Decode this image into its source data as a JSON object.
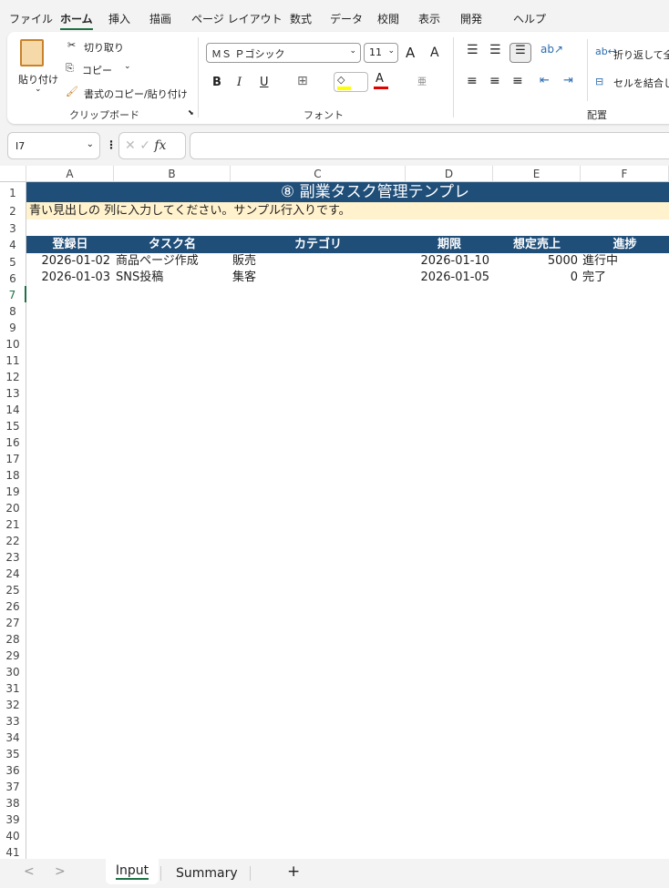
{
  "menu": [
    "ファイル",
    "ホーム",
    "挿入",
    "描画",
    "ページ レイアウト",
    "数式",
    "データ",
    "校閲",
    "表示",
    "開発",
    "ヘルプ"
  ],
  "ribbon": {
    "paste": "貼り付け",
    "cut": "切り取り",
    "copy": "コピー",
    "format_painter": "書式のコピー/貼り付け",
    "clipboard_group": "クリップボード",
    "font_name": "ＭＳ Ｐゴシック",
    "font_size": "11",
    "bold": "B",
    "italic": "I",
    "underline": "U",
    "font_color_letter": "A",
    "grow": "A",
    "shrink": "A",
    "font_group": "フォント",
    "wrap_text": "折り返して全",
    "merge": "セルを結合し",
    "alignment_group": "配置",
    "fill_color": "#ffff00",
    "font_color": "#e00000"
  },
  "formula_bar": {
    "name_box": "I7",
    "fx": "fx",
    "formula": ""
  },
  "columns": [
    "A",
    "B",
    "C",
    "D",
    "E",
    "F"
  ],
  "sheet": {
    "title": "⑧ 副業タスク管理テンプレ",
    "note": "青い見出しの 列に入力してください。サンプル行入りです。",
    "headers": [
      "登録日",
      "タスク名",
      "カテゴリ",
      "期限",
      "想定売上",
      "進捗"
    ],
    "rows": [
      [
        "2026-01-02",
        "商品ページ作成",
        "販売",
        "2026-01-10",
        "5000",
        "進行中"
      ],
      [
        "2026-01-03",
        "SNS投稿",
        "集客",
        "2026-01-05",
        "0",
        "完了"
      ]
    ],
    "header_color": "#1f4e79",
    "note_color": "#fff2cc"
  },
  "tabs": {
    "sheets": [
      "Input",
      "Summary"
    ],
    "active": "Input",
    "add": "+",
    "prev": "<",
    "next": ">"
  }
}
